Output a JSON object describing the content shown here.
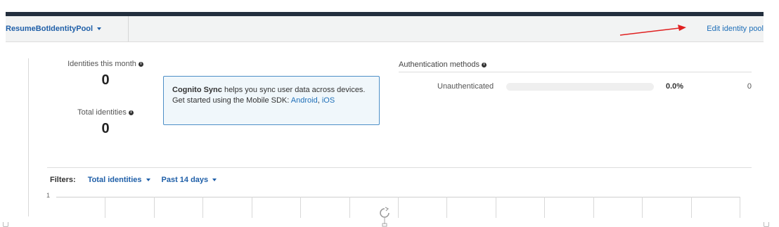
{
  "subheader": {
    "pool_name": "ResumeBotIdentityPool",
    "edit_link": "Edit identity pool"
  },
  "stats": {
    "identities_month_label": "Identities this month",
    "identities_month_value": "0",
    "total_identities_label": "Total identities",
    "total_identities_value": "0"
  },
  "sync_box": {
    "bold": "Cognito Sync",
    "text": " helps you sync user data across devices. Get started using the Mobile SDK: ",
    "link_android": "Android",
    "comma": ",",
    "link_ios": "iOS"
  },
  "auth": {
    "title": "Authentication methods",
    "row_label": "Unauthenticated",
    "percent": "0.0%",
    "count": "0",
    "fraction": 0
  },
  "filters": {
    "label": "Filters:",
    "metric": "Total identities",
    "range": "Past 14 days"
  },
  "chart": {
    "y_tick": "1"
  },
  "colors": {
    "link": "#1f6fb8",
    "annotation_arrow": "#e02020",
    "header_band": "#232f3e"
  },
  "icons": {
    "info": "info-icon",
    "dropdown": "caret-down-icon",
    "loading": "refresh-spinner-icon"
  }
}
